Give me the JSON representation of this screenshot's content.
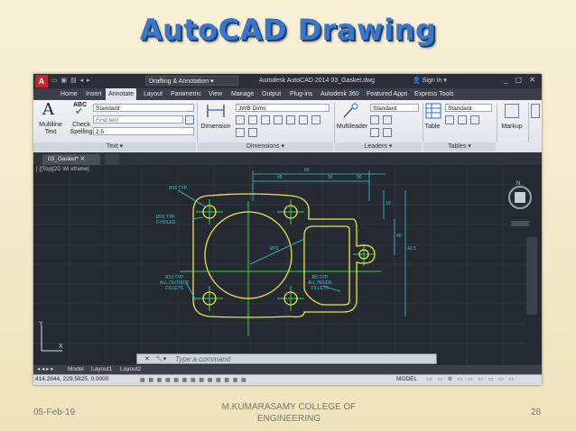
{
  "slide": {
    "title": "AutoCAD Drawing",
    "date": "05-Feb-19",
    "college_line1": "M.KUMARASAMY COLLEGE OF",
    "college_line2": "ENGINEERING",
    "page_number": "28"
  },
  "app": {
    "logo": "A",
    "workspace": "Drafting & Annotation",
    "title": "Autodesk AutoCAD 2014   03_Gasket.dwg",
    "signin": "Sign In",
    "tabs": [
      "Home",
      "Insert",
      "Annotate",
      "Layout",
      "Parametric",
      "View",
      "Manage",
      "Output",
      "Plug-ins",
      "Autodesk 360",
      "Featured Apps",
      "Express Tools"
    ],
    "active_tab": "Annotate"
  },
  "ribbon": {
    "multiline_text_1": "Multiline",
    "multiline_text_2": "Text",
    "check_spelling_1": "Check",
    "check_spelling_2": "Spelling",
    "text_style": "Standard",
    "find_text": "Find text",
    "text_height": "2.5",
    "dimension": "Dimension",
    "dim_style": "JWB Dims",
    "multileader": "Multileader",
    "mleader_style": "Standard",
    "table": "Table",
    "table_style": "Standard",
    "markup": "Markup",
    "panels": {
      "text": "Text ▾",
      "dimensions": "Dimensions ▾",
      "leaders": "Leaders ▾",
      "tables": "Tables ▾"
    }
  },
  "document": {
    "tab": "03_Gasket*",
    "view_label": "[-][Top][2D Wireframe]"
  },
  "drawing": {
    "notes": {
      "r16_typ": "R16 TYP.",
      "holes_1": "Ø10 TYP.",
      "holes_2": "5 HOLES",
      "outside_1": "R10 TYP",
      "outside_2": "ALL OUTSIDE",
      "outside_3": "FILLETS",
      "inside_1": "R5 TYP",
      "inside_2": "ALL INSIDE",
      "inside_3": "FILLETS"
    },
    "dims": {
      "top_overall": "80",
      "top_left": "45",
      "top_mid": "30",
      "top_right": "30",
      "right_1": "10",
      "right_2": "40",
      "right_overall": "42.5",
      "diameter": "Ø70"
    }
  },
  "command": {
    "placeholder": "Type a command"
  },
  "layout_tabs": [
    "Model",
    "Layout1",
    "Layout2"
  ],
  "status": {
    "coords": "414.2844, 229.5825, 0.0000",
    "model": "MODEL"
  },
  "colors": {
    "geometry": "#e8e64a",
    "dimension": "#3fc7c4",
    "centerline": "#3fd23f",
    "title": "#3a77c9"
  }
}
